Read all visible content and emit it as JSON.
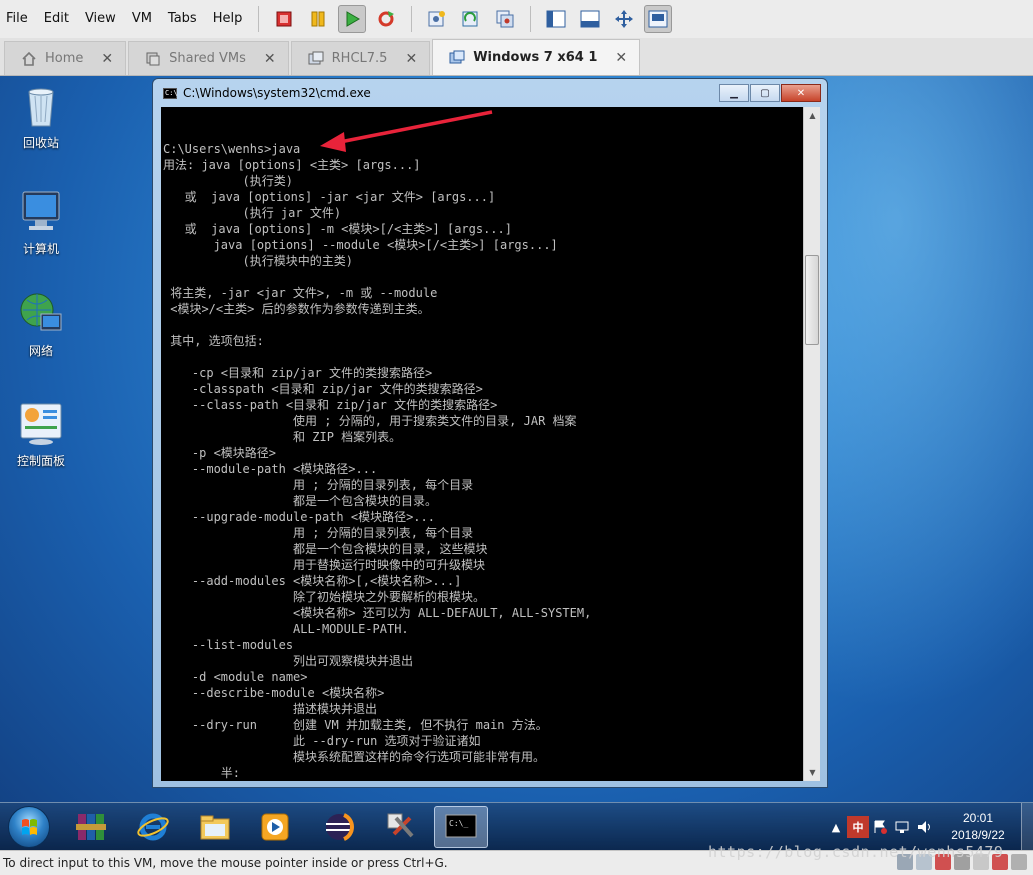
{
  "menu": [
    "File",
    "Edit",
    "View",
    "VM",
    "Tabs",
    "Help"
  ],
  "toolbar": {
    "icons": [
      "power-off-icon",
      "suspend-icon",
      "power-on-icon",
      "reset-icon",
      "snapshot-icon",
      "revert-snapshot-icon",
      "snapshot-manager-icon",
      "sidebar-icon",
      "console-view-icon",
      "fullscreen-icon",
      "unity-icon"
    ]
  },
  "tabs": [
    {
      "label": "Home",
      "icon": "home-icon",
      "active": false
    },
    {
      "label": "Shared VMs",
      "icon": "shared-vms-icon",
      "active": false
    },
    {
      "label": "RHCL7.5",
      "icon": "vm-icon",
      "active": false
    },
    {
      "label": "Windows 7 x64 1",
      "icon": "vm-icon",
      "active": true
    }
  ],
  "desktop": {
    "icons": [
      {
        "label": "回收站",
        "icon": "recycle-bin-icon"
      },
      {
        "label": "计算机",
        "icon": "computer-icon"
      },
      {
        "label": "网络",
        "icon": "network-icon"
      },
      {
        "label": "控制面板",
        "icon": "control-panel-icon"
      }
    ]
  },
  "cmd": {
    "title": "C:\\Windows\\system32\\cmd.exe",
    "lines": [
      "C:\\Users\\wenhs>java",
      "用法: java [options] <主类> [args...]",
      "           (执行类)",
      "   或  java [options] -jar <jar 文件> [args...]",
      "           (执行 jar 文件)",
      "   或  java [options] -m <模块>[/<主类>] [args...]",
      "       java [options] --module <模块>[/<主类>] [args...]",
      "           (执行模块中的主类)",
      "",
      " 将主类, -jar <jar 文件>, -m 或 --module",
      " <模块>/<主类> 后的参数作为参数传递到主类。",
      "",
      " 其中, 选项包括:",
      "",
      "    -cp <目录和 zip/jar 文件的类搜索路径>",
      "    -classpath <目录和 zip/jar 文件的类搜索路径>",
      "    --class-path <目录和 zip/jar 文件的类搜索路径>",
      "                  使用 ; 分隔的, 用于搜索类文件的目录, JAR 档案",
      "                  和 ZIP 档案列表。",
      "    -p <模块路径>",
      "    --module-path <模块路径>...",
      "                  用 ; 分隔的目录列表, 每个目录",
      "                  都是一个包含模块的目录。",
      "    --upgrade-module-path <模块路径>...",
      "                  用 ; 分隔的目录列表, 每个目录",
      "                  都是一个包含模块的目录, 这些模块",
      "                  用于替换运行时映像中的可升级模块",
      "    --add-modules <模块名称>[,<模块名称>...]",
      "                  除了初始模块之外要解析的根模块。",
      "                  <模块名称> 还可以为 ALL-DEFAULT, ALL-SYSTEM,",
      "                  ALL-MODULE-PATH.",
      "    --list-modules",
      "                  列出可观察模块并退出",
      "    -d <module name>",
      "    --describe-module <模块名称>",
      "                  描述模块并退出",
      "    --dry-run     创建 VM 并加载主类, 但不执行 main 方法。",
      "                  此 --dry-run 选项对于验证诸如",
      "                  模块系统配置这样的命令行选项可能非常有用。",
      "        半:"
    ]
  },
  "taskbar": {
    "apps": [
      "winrar-icon",
      "internet-explorer-icon",
      "file-explorer-icon",
      "media-player-icon",
      "eclipse-icon",
      "tools-icon",
      "cmd-icon"
    ],
    "tray": {
      "ime": "中",
      "time": "20:01",
      "date": "2018/9/22"
    }
  },
  "status": {
    "message": "To direct input to this VM, move the mouse pointer inside or press Ctrl+G."
  },
  "watermark": "https://blog.csdn.net/wenhs5479"
}
